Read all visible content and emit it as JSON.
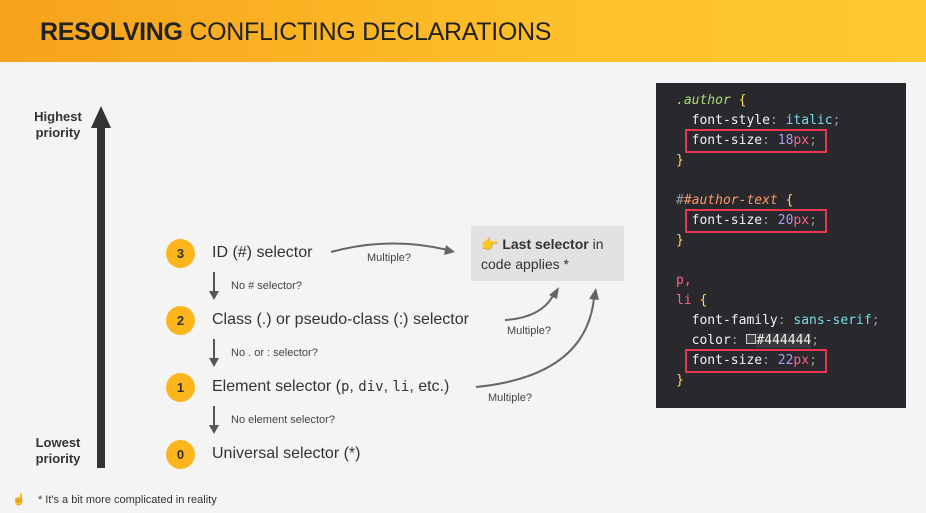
{
  "title": {
    "bold": "RESOLVING",
    "rest": " CONFLICTING DECLARATIONS"
  },
  "priority": {
    "high": "Highest priority",
    "low": "Lowest priority"
  },
  "levels": [
    {
      "num": "3",
      "text": "ID (#) selector"
    },
    {
      "num": "2",
      "text": "Class (.) or pseudo-class (:) selector"
    },
    {
      "num": "1",
      "pre": "Element selector (",
      "code1": "p",
      "sep1": ", ",
      "code2": "div",
      "sep2": ", ",
      "code3": "li",
      "post": ", etc.)"
    },
    {
      "num": "0",
      "text": "Universal selector (*)"
    }
  ],
  "questions": [
    "No # selector?",
    "No . or : selector?",
    "No element selector?"
  ],
  "multiple": "Multiple?",
  "result": {
    "icon": "pointing-hand-icon",
    "emoji": "👉",
    "bold": "Last selector",
    "rest": " in code applies *"
  },
  "code": {
    "l1": ".author",
    "l2": "font-style",
    "l2v": "italic",
    "l3": "font-size",
    "l3n": "18",
    "px": "px",
    "l5": "#author-text",
    "l6n": "20",
    "l8": "p,",
    "l9": "li",
    "l10": "font-family",
    "l10v": "sans-serif",
    "l11": "color",
    "l11v": "#444444",
    "l12n": "22"
  },
  "footer": {
    "emoji": "☝",
    "text": "* It's a bit more complicated in reality"
  },
  "colors": {
    "accent": "#fcb51a",
    "highlight": "#e8364f",
    "code_bg": "#29282c"
  }
}
